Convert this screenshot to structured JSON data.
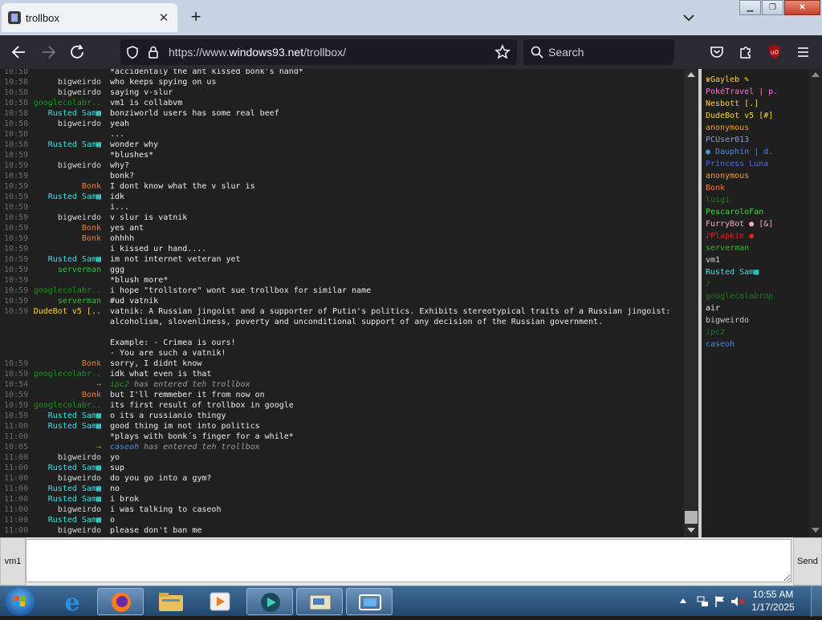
{
  "browser": {
    "tab_title": "trollbox",
    "new_tab": "+",
    "tab_close": "✕",
    "url_prefix": "https://www.",
    "url_domain": "windows93.net",
    "url_path": "/trollbox/",
    "search_placeholder": "Search",
    "extension_badge": "uO"
  },
  "chat": {
    "messages": [
      {
        "time": "10:58",
        "nick": "",
        "text": "*accidentaly the ant kissed bonk's hand*",
        "color": "#e0e0e0"
      },
      {
        "time": "10:58",
        "nick": "bigweirdo",
        "text": "who keeps spying on us",
        "color": "#d8d8d8"
      },
      {
        "time": "10:58",
        "nick": "bigweirdo",
        "text": "saying v-slur",
        "color": "#d8d8d8"
      },
      {
        "time": "10:58",
        "nick": "googlecolabr..",
        "text": "vm1 is collabvm",
        "color": "#1e8f1e"
      },
      {
        "time": "10:58",
        "nick": "Rusted Sam▩",
        "text": "bonziworld users has some real beef",
        "color": "#3fe0e0"
      },
      {
        "time": "10:58",
        "nick": "bigweirdo",
        "text": "yeah",
        "color": "#d8d8d8"
      },
      {
        "time": "10:58",
        "nick": "",
        "text": "...",
        "color": "#e0e0e0"
      },
      {
        "time": "10:58",
        "nick": "Rusted Sam▩",
        "text": "wonder why",
        "color": "#3fe0e0"
      },
      {
        "time": "10:59",
        "nick": "",
        "text": "*blushes*",
        "color": "#e0e0e0"
      },
      {
        "time": "10:59",
        "nick": "bigweirdo",
        "text": "why?",
        "color": "#d8d8d8"
      },
      {
        "time": "10:59",
        "nick": "",
        "text": "bonk?",
        "color": "#e0e0e0"
      },
      {
        "time": "10:59",
        "nick": "Bonk",
        "text": "I dont know what the v slur is",
        "color": "#f07a3a"
      },
      {
        "time": "10:59",
        "nick": "Rusted Sam▩",
        "text": "idk",
        "color": "#3fe0e0"
      },
      {
        "time": "10:59",
        "nick": "",
        "text": "i...",
        "color": "#e0e0e0"
      },
      {
        "time": "10:59",
        "nick": "bigweirdo",
        "text": "v slur is vatnik",
        "color": "#d8d8d8"
      },
      {
        "time": "10:59",
        "nick": "Bonk",
        "text": "yes ant",
        "color": "#f07a3a"
      },
      {
        "time": "10:59",
        "nick": "Bonk",
        "text": "ohhhh",
        "color": "#f07a3a"
      },
      {
        "time": "10:59",
        "nick": "",
        "text": "i kissed ur hand....",
        "color": "#e0e0e0"
      },
      {
        "time": "10:59",
        "nick": "Rusted Sam▩",
        "text": "im not internet veteran yet",
        "color": "#3fe0e0"
      },
      {
        "time": "10:59",
        "nick": "serverman",
        "text": "ggg",
        "color": "#2fbf2f"
      },
      {
        "time": "10:59",
        "nick": "",
        "text": "*blush more*",
        "color": "#e0e0e0"
      },
      {
        "time": "10:59",
        "nick": "googlecolabr..",
        "text": "i hope \"trollstore\" wont sue trollbox for similar name",
        "color": "#1e8f1e"
      },
      {
        "time": "10:59",
        "nick": "serverman",
        "text": "#ud vatnik",
        "color": "#2fbf2f"
      },
      {
        "time": "10:59",
        "nick": "DudeBot v5 [..",
        "text": "vatnik: A Russian jingoist and a supporter of Putin's politics. Exhibits stereotypical traits of a Russian jingoist:",
        "color": "#ffd23a"
      },
      {
        "time": "",
        "nick": "",
        "text": "alcoholism, slovenliness, poverty and unconditional support of any decision of the Russian government.",
        "color": "#e0e0e0"
      },
      {
        "time": "",
        "nick": "",
        "text": "",
        "color": "#e0e0e0"
      },
      {
        "time": "",
        "nick": "",
        "text": "Example: - Crimea is ours!",
        "color": "#e0e0e0"
      },
      {
        "time": "",
        "nick": "",
        "text": "- You are such a vatnik!",
        "color": "#e0e0e0"
      },
      {
        "time": "10:59",
        "nick": "Bonk",
        "text": "sorry, I didnt know",
        "color": "#f07a3a"
      },
      {
        "time": "10:59",
        "nick": "googlecolabr..",
        "text": "idk what even is that",
        "color": "#1e8f1e"
      },
      {
        "time": "10:54",
        "nick": "→",
        "text": "has entered teh trollbox",
        "who": "ipc2",
        "who_color": "#1e8f1e",
        "system": true,
        "color": "#2fbf2f"
      },
      {
        "time": "10:59",
        "nick": "Bonk",
        "text": "but I'll remmeber it from now on",
        "color": "#f07a3a"
      },
      {
        "time": "10:59",
        "nick": "googlecolabr..",
        "text": "its first result of trollbox in google",
        "color": "#1e8f1e"
      },
      {
        "time": "10:59",
        "nick": "Rusted Sam▩",
        "text": "o its a russianio thingy",
        "color": "#3fe0e0"
      },
      {
        "time": "11:00",
        "nick": "Rusted Sam▩",
        "text": "good thing im not into politics",
        "color": "#3fe0e0"
      },
      {
        "time": "11:00",
        "nick": "",
        "text": "*plays with bonk´s finger for a while*",
        "color": "#e0e0e0"
      },
      {
        "time": "10:05",
        "nick": "→",
        "text": "has entered teh trollbox",
        "who": "caseoh",
        "who_color": "#3f8fe6",
        "system": true,
        "color": "#2fbf2f"
      },
      {
        "time": "11:00",
        "nick": "bigweirdo",
        "text": "yo",
        "color": "#d8d8d8"
      },
      {
        "time": "11:00",
        "nick": "Rusted Sam▩",
        "text": "sup",
        "color": "#3fe0e0"
      },
      {
        "time": "11:00",
        "nick": "bigweirdo",
        "text": "do you go into a gym?",
        "color": "#d8d8d8"
      },
      {
        "time": "11:00",
        "nick": "Rusted Sam▩",
        "text": "no",
        "color": "#3fe0e0"
      },
      {
        "time": "11:00",
        "nick": "Rusted Sam▩",
        "text": "i brok",
        "color": "#3fe0e0"
      },
      {
        "time": "11:00",
        "nick": "bigweirdo",
        "text": "i was talking to caseoh",
        "color": "#d8d8d8"
      },
      {
        "time": "11:00",
        "nick": "Rusted Sam▩",
        "text": "o",
        "color": "#3fe0e0"
      },
      {
        "time": "11:00",
        "nick": "bigweirdo",
        "text": "please don't ban me",
        "color": "#d8d8d8"
      }
    ]
  },
  "users": [
    {
      "name": "♛Gayleb ✎",
      "color": "#ffd23a"
    },
    {
      "name": "PokéTravel | p.",
      "color": "#ff6fd8"
    },
    {
      "name": "Nesbott [.]",
      "color": "#ffd23a"
    },
    {
      "name": "DudeBot v5 [#]",
      "color": "#ffd23a"
    },
    {
      "name": "anonymous",
      "color": "#f0a020"
    },
    {
      "name": "PCUser013",
      "color": "#8aa0c8"
    },
    {
      "name": "● Dauphin | d.",
      "color": "#4a8fe0"
    },
    {
      "name": "Princess Luna",
      "color": "#4a70d8"
    },
    {
      "name": "anonymous",
      "color": "#f0a020"
    },
    {
      "name": "Bonk",
      "color": "#f07a3a"
    },
    {
      "name": "luigi",
      "color": "#1e7a1e"
    },
    {
      "name": "PescaroloFan",
      "color": "#3ad83a"
    },
    {
      "name": "FurryBot ● [&]",
      "color": "#f0a8c8"
    },
    {
      "name": "♪Plapkin ●",
      "color": "#e02020"
    },
    {
      "name": "serverman",
      "color": "#2fbf2f"
    },
    {
      "name": "vm1",
      "color": "#d8d8d8"
    },
    {
      "name": "Rusted Sam▩",
      "color": "#3fe0e0"
    },
    {
      "name": "♪",
      "color": "#1e7a1e"
    },
    {
      "name": "googlecolabrop",
      "color": "#1e7a1e"
    },
    {
      "name": "air",
      "color": "#e8e8e8"
    },
    {
      "name": "bigweirdo",
      "color": "#c8c8c8"
    },
    {
      "name": "ipc2",
      "color": "#1e7a1e"
    },
    {
      "name": "caseoh",
      "color": "#3f8fe6"
    }
  ],
  "input": {
    "nick_button": "vm1",
    "send_button": "Send",
    "message_value": ""
  },
  "taskbar": {
    "time": "10:55 AM",
    "date": "1/17/2025"
  }
}
